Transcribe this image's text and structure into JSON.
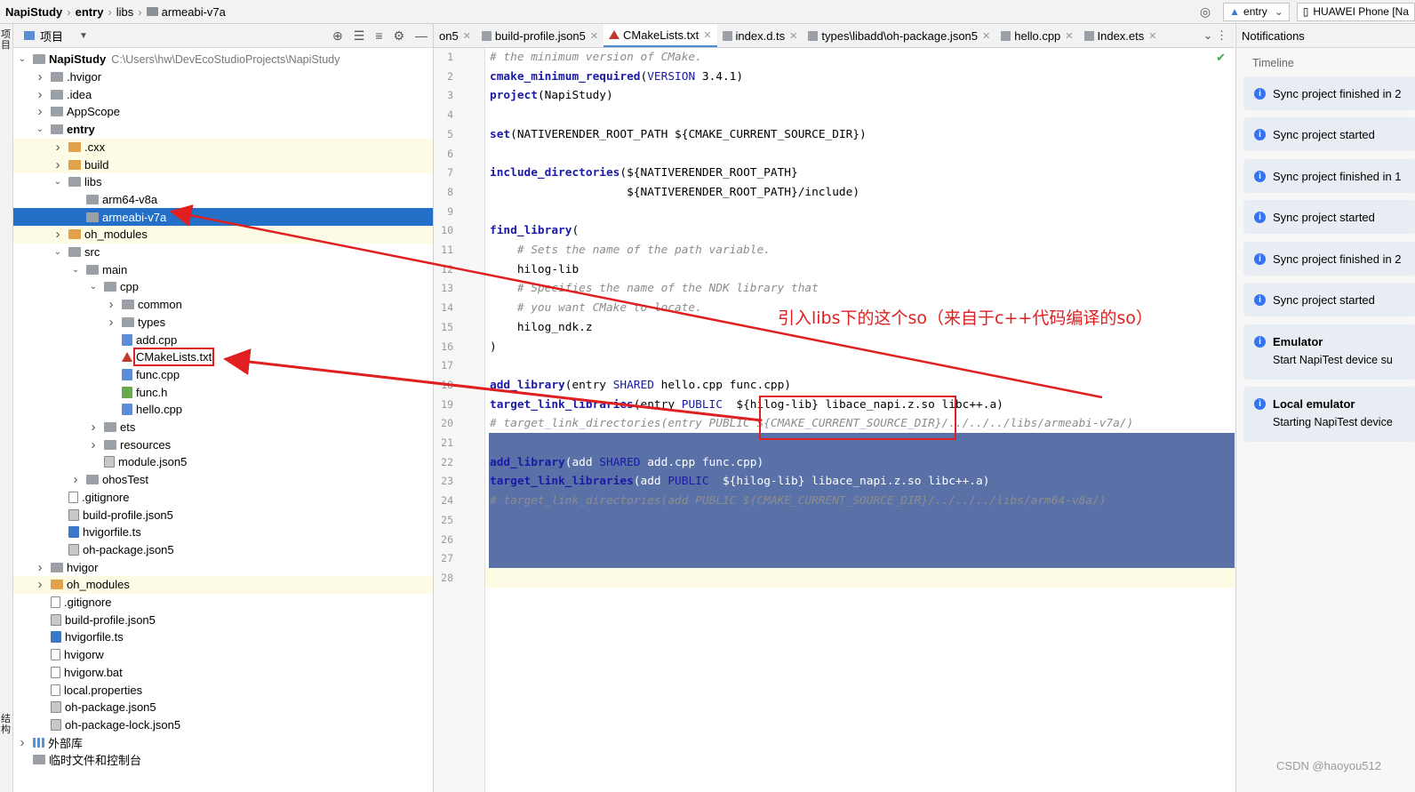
{
  "breadcrumb": [
    "NapiStudy",
    "entry",
    "libs",
    "armeabi-v7a"
  ],
  "run_config": "entry",
  "device": "HUAWEI Phone [Na",
  "left_toolwindow": {
    "project_label": "项目",
    "structure_label": "结构"
  },
  "project_panel": {
    "view_label": "项目"
  },
  "tree": [
    {
      "label": "NapiStudy",
      "path": "C:\\Users\\hw\\DevEcoStudioProjects\\NapiStudy",
      "depth": 0,
      "arrow": "down",
      "icon": "folder",
      "bold": true
    },
    {
      "label": ".hvigor",
      "depth": 1,
      "arrow": "right",
      "icon": "folder"
    },
    {
      "label": ".idea",
      "depth": 1,
      "arrow": "right",
      "icon": "folder"
    },
    {
      "label": "AppScope",
      "depth": 1,
      "arrow": "right",
      "icon": "folder"
    },
    {
      "label": "entry",
      "depth": 1,
      "arrow": "down",
      "icon": "folder",
      "bold": true
    },
    {
      "label": ".cxx",
      "depth": 2,
      "arrow": "right",
      "icon": "orange",
      "hl": true
    },
    {
      "label": "build",
      "depth": 2,
      "arrow": "right",
      "icon": "orange",
      "hl": true
    },
    {
      "label": "libs",
      "depth": 2,
      "arrow": "down",
      "icon": "folder"
    },
    {
      "label": "arm64-v8a",
      "depth": 3,
      "arrow": "",
      "icon": "folder"
    },
    {
      "label": "armeabi-v7a",
      "depth": 3,
      "arrow": "",
      "icon": "folder",
      "selected": true
    },
    {
      "label": "oh_modules",
      "depth": 2,
      "arrow": "right",
      "icon": "orange",
      "hl": true
    },
    {
      "label": "src",
      "depth": 2,
      "arrow": "down",
      "icon": "folder"
    },
    {
      "label": "main",
      "depth": 3,
      "arrow": "down",
      "icon": "folder"
    },
    {
      "label": "cpp",
      "depth": 4,
      "arrow": "down",
      "icon": "folder"
    },
    {
      "label": "common",
      "depth": 5,
      "arrow": "right",
      "icon": "folder"
    },
    {
      "label": "types",
      "depth": 5,
      "arrow": "right",
      "icon": "folder"
    },
    {
      "label": "add.cpp",
      "depth": 5,
      "arrow": "",
      "icon": "cpp"
    },
    {
      "label": "CMakeLists.txt",
      "depth": 5,
      "arrow": "",
      "icon": "cmake",
      "boxed": true
    },
    {
      "label": "func.cpp",
      "depth": 5,
      "arrow": "",
      "icon": "cpp"
    },
    {
      "label": "func.h",
      "depth": 5,
      "arrow": "",
      "icon": "h"
    },
    {
      "label": "hello.cpp",
      "depth": 5,
      "arrow": "",
      "icon": "cpp"
    },
    {
      "label": "ets",
      "depth": 4,
      "arrow": "right",
      "icon": "folder"
    },
    {
      "label": "resources",
      "depth": 4,
      "arrow": "right",
      "icon": "folder"
    },
    {
      "label": "module.json5",
      "depth": 4,
      "arrow": "",
      "icon": "json"
    },
    {
      "label": "ohosTest",
      "depth": 3,
      "arrow": "right",
      "icon": "folder"
    },
    {
      "label": ".gitignore",
      "depth": 2,
      "arrow": "",
      "icon": "file"
    },
    {
      "label": "build-profile.json5",
      "depth": 2,
      "arrow": "",
      "icon": "json"
    },
    {
      "label": "hvigorfile.ts",
      "depth": 2,
      "arrow": "",
      "icon": "ts"
    },
    {
      "label": "oh-package.json5",
      "depth": 2,
      "arrow": "",
      "icon": "json"
    },
    {
      "label": "hvigor",
      "depth": 1,
      "arrow": "right",
      "icon": "folder"
    },
    {
      "label": "oh_modules",
      "depth": 1,
      "arrow": "right",
      "icon": "orange",
      "hl": true
    },
    {
      "label": ".gitignore",
      "depth": 1,
      "arrow": "",
      "icon": "file"
    },
    {
      "label": "build-profile.json5",
      "depth": 1,
      "arrow": "",
      "icon": "json"
    },
    {
      "label": "hvigorfile.ts",
      "depth": 1,
      "arrow": "",
      "icon": "ts"
    },
    {
      "label": "hvigorw",
      "depth": 1,
      "arrow": "",
      "icon": "file"
    },
    {
      "label": "hvigorw.bat",
      "depth": 1,
      "arrow": "",
      "icon": "file"
    },
    {
      "label": "local.properties",
      "depth": 1,
      "arrow": "",
      "icon": "file"
    },
    {
      "label": "oh-package.json5",
      "depth": 1,
      "arrow": "",
      "icon": "json"
    },
    {
      "label": "oh-package-lock.json5",
      "depth": 1,
      "arrow": "",
      "icon": "json"
    },
    {
      "label": "外部库",
      "depth": 0,
      "arrow": "right",
      "icon": "libs"
    },
    {
      "label": "临时文件和控制台",
      "depth": 0,
      "arrow": "",
      "icon": "folder"
    }
  ],
  "tabs": [
    {
      "label": "on5",
      "active": false,
      "icon": "none"
    },
    {
      "label": "build-profile.json5",
      "active": false,
      "icon": "json"
    },
    {
      "label": "CMakeLists.txt",
      "active": true,
      "icon": "cmake"
    },
    {
      "label": "index.d.ts",
      "active": false,
      "icon": "ts"
    },
    {
      "label": "types\\libadd\\oh-package.json5",
      "active": false,
      "icon": "json"
    },
    {
      "label": "hello.cpp",
      "active": false,
      "icon": "cpp"
    },
    {
      "label": "Index.ets",
      "active": false,
      "icon": "ts"
    }
  ],
  "code_lines": [
    "# the minimum version of CMake.",
    "cmake_minimum_required(VERSION 3.4.1)",
    "project(NapiStudy)",
    "",
    "set(NATIVERENDER_ROOT_PATH ${CMAKE_CURRENT_SOURCE_DIR})",
    "",
    "include_directories(${NATIVERENDER_ROOT_PATH}",
    "                    ${NATIVERENDER_ROOT_PATH}/include)",
    "",
    "find_library(",
    "    # Sets the name of the path variable.",
    "    hilog-lib",
    "    # Specifies the name of the NDK library that",
    "    # you want CMake to locate.",
    "    hilog_ndk.z",
    ")",
    "",
    "add_library(entry SHARED hello.cpp func.cpp)",
    "target_link_libraries(entry PUBLIC  ${hilog-lib} libace_napi.z.so libc++.a)",
    "# target_link_directories(entry PUBLIC ${CMAKE_CURRENT_SOURCE_DIR}/../../../libs/armeabi-v7a/)",
    "",
    "add_library(add SHARED add.cpp func.cpp)",
    "target_link_libraries(add PUBLIC  ${hilog-lib} libace_napi.z.so libc++.a)",
    "# target_link_directories(add PUBLIC ${CMAKE_CURRENT_SOURCE_DIR}/../../../libs/arm64-v8a/)",
    "",
    "",
    "",
    ""
  ],
  "annotation": "引入libs下的这个so（来自于c++代码编译的so）",
  "notifications": {
    "title": "Notifications",
    "timeline_label": "Timeline",
    "items": [
      {
        "title": "Sync project finished in 2",
        "sub": ""
      },
      {
        "title": "Sync project started",
        "sub": ""
      },
      {
        "title": "Sync project finished in 1",
        "sub": ""
      },
      {
        "title": "Sync project started",
        "sub": ""
      },
      {
        "title": "Sync project finished in 2",
        "sub": ""
      },
      {
        "title": "Sync project started",
        "sub": ""
      },
      {
        "title": "Emulator",
        "sub": "Start NapiTest device su"
      },
      {
        "title": "Local emulator",
        "sub": "Starting NapiTest device"
      }
    ]
  },
  "watermark": "CSDN @haoyou512",
  "colors": {
    "selection": "#2470c9",
    "annotation": "#e02020",
    "code_selection": "#5a71a8",
    "keyword": "#1a1aa6"
  }
}
